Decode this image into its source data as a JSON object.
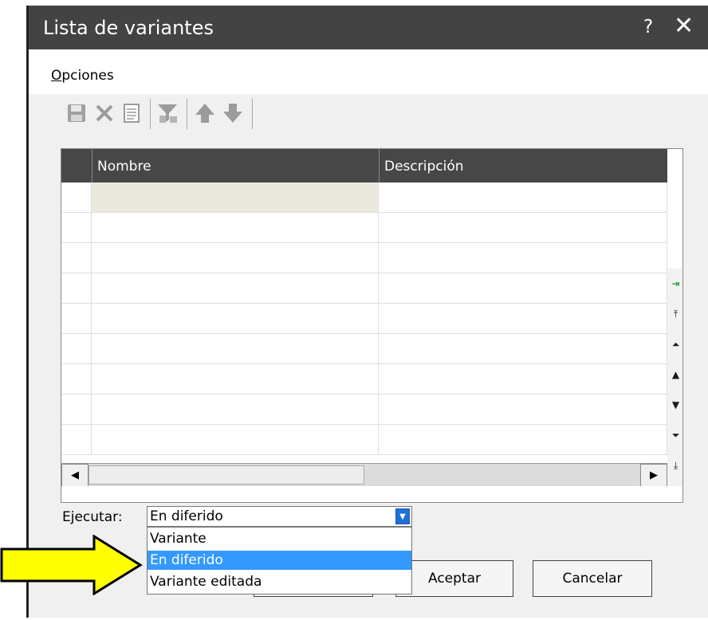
{
  "window": {
    "title": "Lista de variantes",
    "help": "?",
    "close": "✕"
  },
  "menu": {
    "opciones_first": "O",
    "opciones_rest": "pciones"
  },
  "toolbar": {
    "items": [
      {
        "name": "save-icon"
      },
      {
        "name": "delete-icon"
      },
      {
        "name": "document-icon"
      },
      {
        "name": "filter-icon"
      },
      {
        "name": "move-up-icon"
      },
      {
        "name": "move-down-icon"
      }
    ],
    "color": "#9b9b9b"
  },
  "grid": {
    "columns": [
      "Nombre",
      "Descripción"
    ],
    "rows": [
      "",
      "",
      "",
      "",
      "",
      "",
      "",
      "",
      ""
    ],
    "header_color": "#474747",
    "selected_cell_color": "#ebe8dd"
  },
  "vscroll": {
    "buttons": [
      {
        "name": "goto-icon",
        "glyph": "⇥"
      },
      {
        "name": "first-icon",
        "glyph": "⤒"
      },
      {
        "name": "page-up-icon",
        "glyph": "⏶"
      },
      {
        "name": "up-icon",
        "glyph": "▲"
      },
      {
        "name": "down-icon",
        "glyph": "▼"
      },
      {
        "name": "page-down-icon",
        "glyph": "⏷"
      },
      {
        "name": "last-icon",
        "glyph": "⤓"
      }
    ]
  },
  "hscroll": {
    "left": "◀",
    "right": "▶"
  },
  "ejecutar": {
    "label": "Ejecutar:",
    "value": "En diferido",
    "options": [
      "Variante",
      "En diferido",
      "Variante editada"
    ],
    "selected_index": 1,
    "accent": "#3399ff"
  },
  "buttons": {
    "accept": "Aceptar",
    "cancel": "Cancelar"
  },
  "annotation": {
    "arrow_color": "#ffff00"
  }
}
